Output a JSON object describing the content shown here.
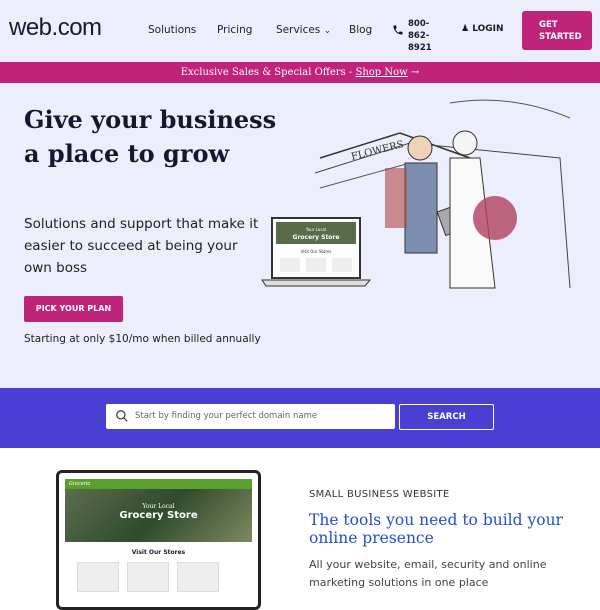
{
  "header": {
    "logo": "web.com",
    "nav": [
      "Solutions",
      "Pricing",
      "Services",
      "Blog"
    ],
    "phone": "800-862-8921",
    "login": "LOGIN",
    "cta": "GET STARTED"
  },
  "promo": {
    "text": "Exclusive Sales & Special Offers - ",
    "link": "Shop Now"
  },
  "hero": {
    "title": "Give your business a place to grow",
    "subtitle": "Solutions and support that make it easier to succeed at being your own boss",
    "button": "PICK YOUR PLAN",
    "note": "Starting at only $10/mo when billed annually",
    "mock": {
      "sign": "FLOWERS",
      "kicker": "Your Local",
      "store": "Grocery Store",
      "section": "Visit Our Stores"
    }
  },
  "search": {
    "placeholder": "Start by finding your perfect domain name",
    "button": "SEARCH"
  },
  "feature": {
    "kicker": "SMALL BUSINESS WEBSITE",
    "title": "The tools you need to build your online presence",
    "description": "All your website, email, security and online marketing solutions in one place",
    "mock": {
      "brand": "Grocerio",
      "kicker": "Your Local",
      "store": "Grocery Store",
      "section": "Visit Our Stores"
    }
  },
  "colors": {
    "accent": "#c0237a",
    "band": "#4a3fd4",
    "heading_blue": "#2050d0",
    "bg": "#eceefb"
  }
}
